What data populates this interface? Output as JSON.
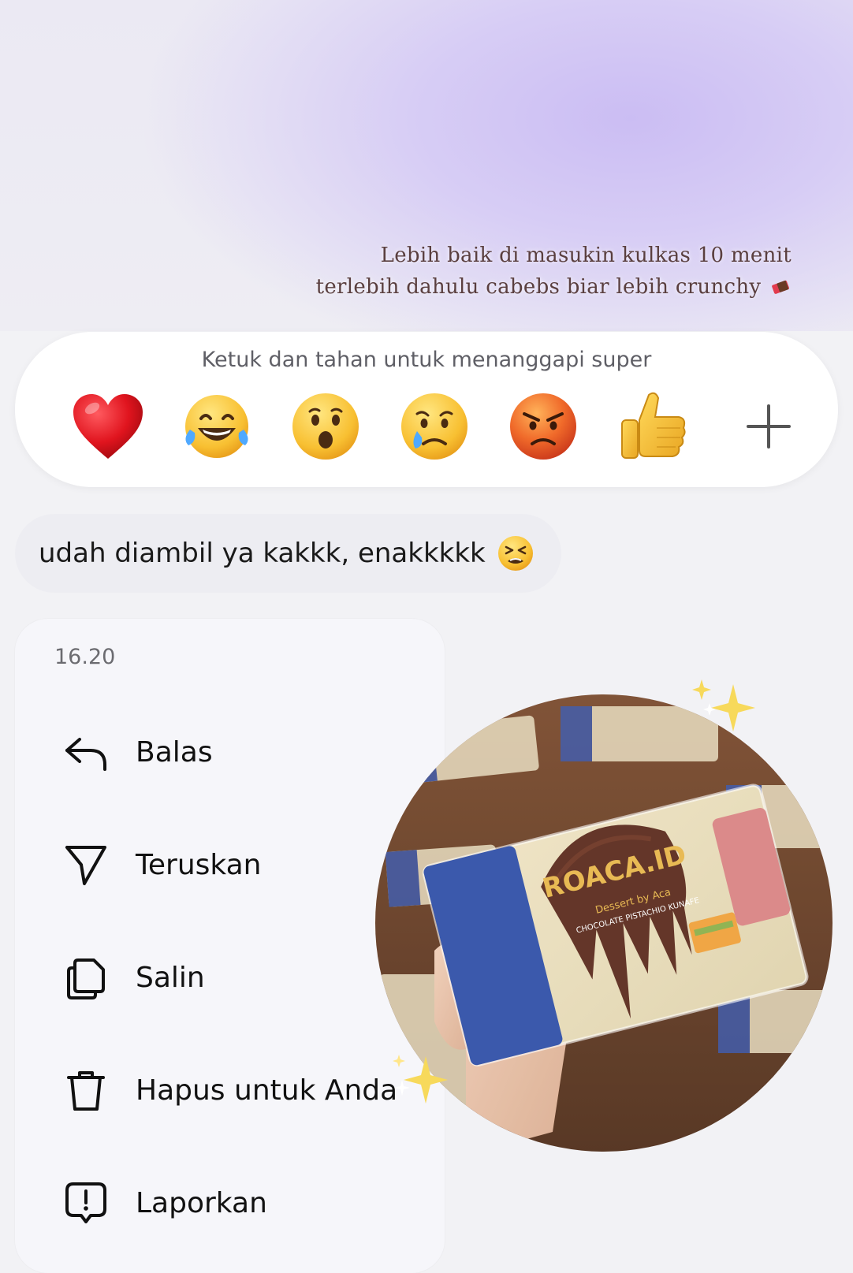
{
  "caption": {
    "line1": "Lebih baik di masukin kulkas 10 menit",
    "line2": "terlebih dahulu cabebs biar lebih crunchy"
  },
  "reaction_bar": {
    "hint": "Ketuk dan tahan untuk menanggapi super",
    "reactions": [
      "heart",
      "laughing-tears",
      "surprised",
      "crying",
      "angry",
      "thumbs-up"
    ],
    "more_icon": "plus-icon"
  },
  "message": {
    "text": "udah diambil ya kakkk, enakkkkk"
  },
  "context_menu": {
    "time": "16.20",
    "items": [
      {
        "label": "Balas",
        "icon": "reply-icon"
      },
      {
        "label": "Teruskan",
        "icon": "send-icon"
      },
      {
        "label": "Salin",
        "icon": "copy-icon"
      },
      {
        "label": "Hapus untuk Anda",
        "icon": "trash-icon"
      },
      {
        "label": "Laporkan",
        "icon": "report-icon"
      }
    ]
  },
  "sticker": {
    "brand": "ROACA.ID",
    "subtitle": "Dessert by Aca",
    "product": "CHOCOLATE PISTACHIO KUNAFE"
  },
  "colors": {
    "accent_purple": "#cbbdf3",
    "heart_red": "#e0141e",
    "emoji_yellow": "#f8c032",
    "angry_orange": "#e8541f",
    "chocolate": "#5b2a1c",
    "wrapper_blue": "#2f4fa7"
  }
}
